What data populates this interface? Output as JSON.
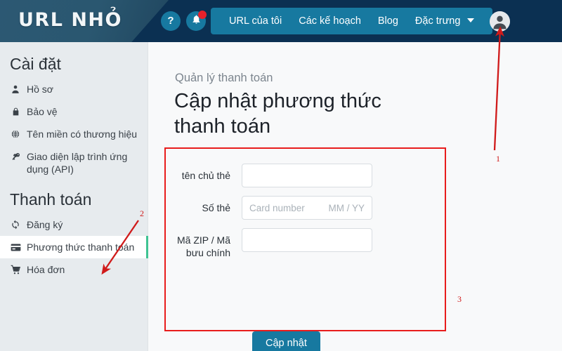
{
  "header": {
    "logo": "URL NHỎ",
    "help_icon": "question-mark-icon",
    "bell_icon": "bell-icon",
    "nav_items": [
      {
        "label": "URL của tôi",
        "has_caret": false
      },
      {
        "label": "Các kế hoạch",
        "has_caret": false
      },
      {
        "label": "Blog",
        "has_caret": false
      },
      {
        "label": "Đặc trưng",
        "has_caret": true
      }
    ],
    "avatar_icon": "user-avatar-icon",
    "colors": {
      "bar_dark": "#0b3052",
      "logo_panel": "#2c5873",
      "accent_teal": "#1779a0",
      "notification_dot": "#e8212b"
    }
  },
  "sidebar": {
    "sections": [
      {
        "title": "Cài đặt",
        "items": [
          {
            "label": "Hồ sơ",
            "icon": "person-icon",
            "active": false
          },
          {
            "label": "Bảo vệ",
            "icon": "lock-icon",
            "active": false
          },
          {
            "label": "Tên miền có thương hiệu",
            "icon": "globe-icon",
            "active": false
          },
          {
            "label": "Giao diện lập trình ứng dụng (API)",
            "icon": "key-icon",
            "active": false
          }
        ]
      },
      {
        "title": "Thanh toán",
        "items": [
          {
            "label": "Đăng ký",
            "icon": "sync-icon",
            "active": false
          },
          {
            "label": "Phương thức thanh toán",
            "icon": "credit-card-icon",
            "active": true
          },
          {
            "label": "Hóa đơn",
            "icon": "shopping-cart-icon",
            "active": false
          }
        ]
      }
    ],
    "active_accent_color": "#3fc392",
    "background_color": "#e7ebee"
  },
  "main": {
    "subtitle": "Quản lý thanh toán",
    "title": "Cập nhật phương thức thanh toán",
    "form": {
      "fields": [
        {
          "label": "tên chủ thẻ",
          "value": "",
          "placeholder": "",
          "placeholder_right": ""
        },
        {
          "label": "Số thẻ",
          "value": "",
          "placeholder": "Card number",
          "placeholder_right": "MM / YY"
        },
        {
          "label": "Mã ZIP / Mã bưu chính",
          "value": "",
          "placeholder": "",
          "placeholder_right": ""
        }
      ],
      "submit_label": "Cập nhật",
      "submit_color": "#1779a0",
      "highlight_border_color": "#e81c1c"
    }
  },
  "annotations": {
    "color": "#d01a1a",
    "markers": [
      {
        "number": "1",
        "target": "avatar-icon"
      },
      {
        "number": "2",
        "target": "sidebar-item-payment-method"
      },
      {
        "number": "3",
        "target": "payment-form-box"
      }
    ]
  }
}
